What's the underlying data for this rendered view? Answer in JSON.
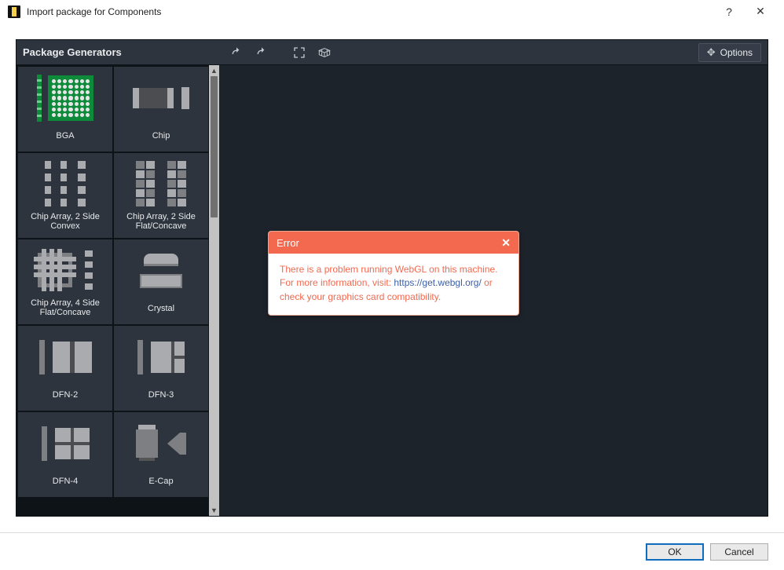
{
  "window": {
    "title": "Import package for Components",
    "help_glyph": "?",
    "close_glyph": "✕"
  },
  "sidebar": {
    "title": "Package Generators",
    "items": [
      {
        "id": "bga",
        "label": "BGA"
      },
      {
        "id": "chip",
        "label": "Chip"
      },
      {
        "id": "carr2c",
        "label": "Chip Array, 2 Side Convex"
      },
      {
        "id": "carr2f",
        "label": "Chip Array, 2 Side Flat/Concave"
      },
      {
        "id": "carr4f",
        "label": "Chip Array, 4 Side Flat/Concave"
      },
      {
        "id": "cryst",
        "label": "Crystal"
      },
      {
        "id": "dfn2",
        "label": "DFN-2"
      },
      {
        "id": "dfn3",
        "label": "DFN-3"
      },
      {
        "id": "dfn4",
        "label": "DFN-4"
      },
      {
        "id": "ecap",
        "label": "E-Cap"
      }
    ]
  },
  "toolbar": {
    "undo": "Undo",
    "redo": "Redo",
    "fit": "Zoom to Fit",
    "grid": "3D Grid",
    "options_label": "Options"
  },
  "error": {
    "title": "Error",
    "msg_before": "There is a problem running WebGL on this machine. For more information, visit: ",
    "link_text": "https://get.webgl.org/",
    "msg_after": " or check your graphics card compatibility.",
    "close_glyph": "✕"
  },
  "footer": {
    "ok": "OK",
    "cancel": "Cancel"
  }
}
